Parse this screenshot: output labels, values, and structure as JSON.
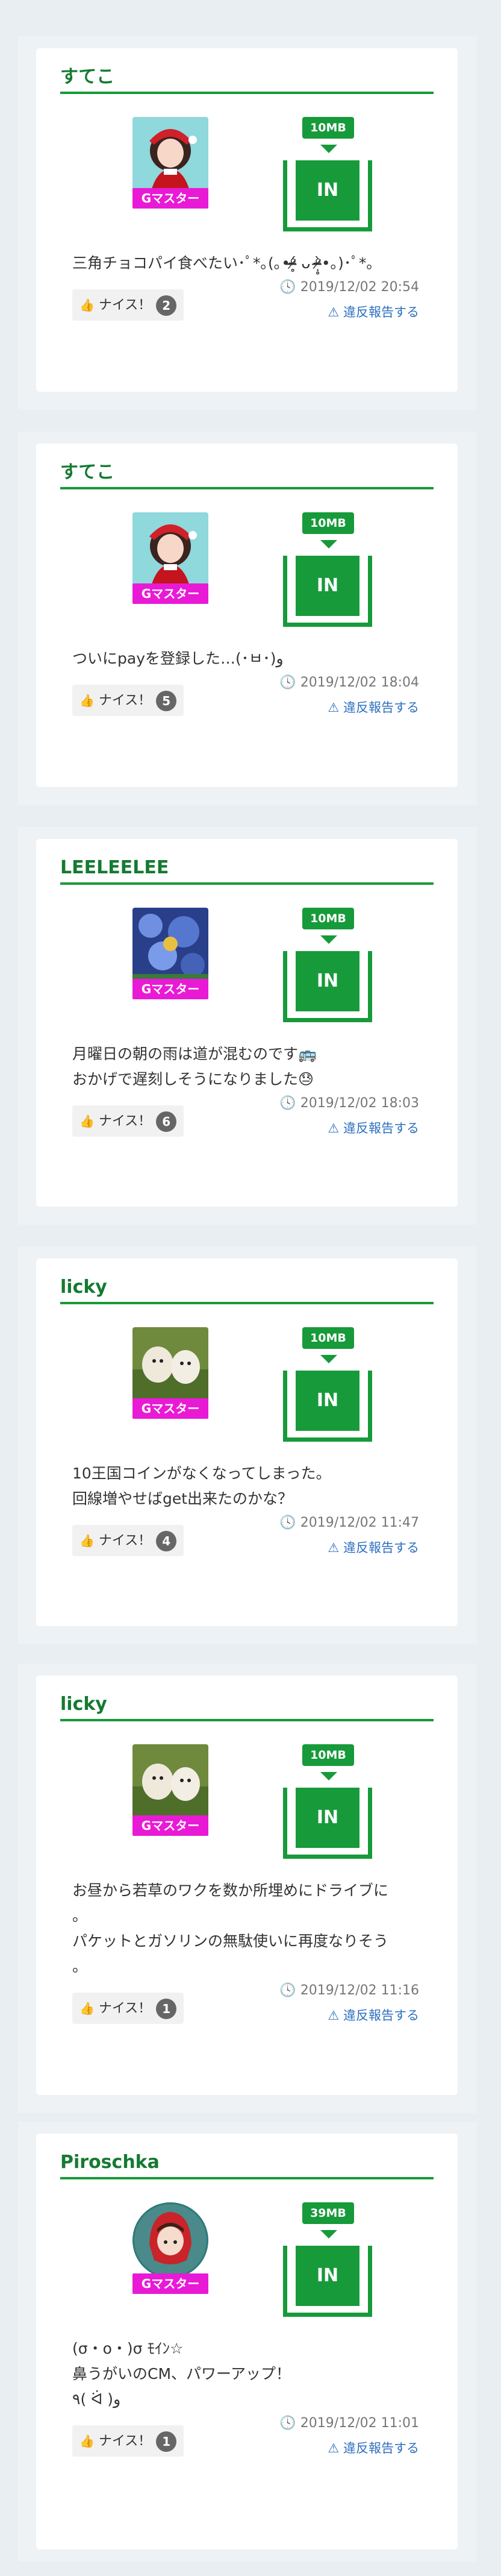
{
  "nice_label": "ナイス！",
  "report_label": "違反報告する",
  "badge_label": "Gマスター",
  "gift_label": "IN",
  "posts": [
    {
      "user": "すてこ",
      "mb": "10MB",
      "text": "三角チョコパイ食べたい･ﾟ*｡(｡•ᵒ̴̶̷̥́ ᴗ ᵒ̴̶̷̣̥̀•｡)･ﾟ*｡",
      "nice": "2",
      "date": "2019/12/02 20:54",
      "avatar": "santa-girl-avatar"
    },
    {
      "user": "すてこ",
      "mb": "10MB",
      "text": "ついにpayを登録した…(･ㅂ･)و",
      "nice": "5",
      "date": "2019/12/02 18:04",
      "avatar": "santa-girl-avatar"
    },
    {
      "user": "LEELEELEE",
      "mb": "10MB",
      "text": "月曜日の朝の雨は道が混むのです🚌\nおかげで遅刻しそうになりました😓",
      "nice": "6",
      "date": "2019/12/02 18:03",
      "avatar": "flowers-avatar"
    },
    {
      "user": "licky",
      "mb": "10MB",
      "text": "10王国コインがなくなってしまった。\n回線増やせばget出来たのかな？",
      "nice": "4",
      "date": "2019/12/02 11:47",
      "avatar": "puppies-avatar"
    },
    {
      "user": "licky",
      "mb": "10MB",
      "text": "お昼から若草のワクを数か所埋めにドライブに\n。\nパケットとガソリンの無駄使いに再度なりそう\n。",
      "nice": "1",
      "date": "2019/12/02 11:16",
      "avatar": "puppies-avatar"
    },
    {
      "user": "Piroschka",
      "mb": "39MB",
      "text": "(σ・ο・)σ ﾓｲﾝ☆\n鼻うがいのCM、パワーアップ！\n٩( ᐛ )و",
      "nice": "1",
      "date": "2019/12/02 11:01",
      "avatar": "red-hood-avatar"
    }
  ]
}
